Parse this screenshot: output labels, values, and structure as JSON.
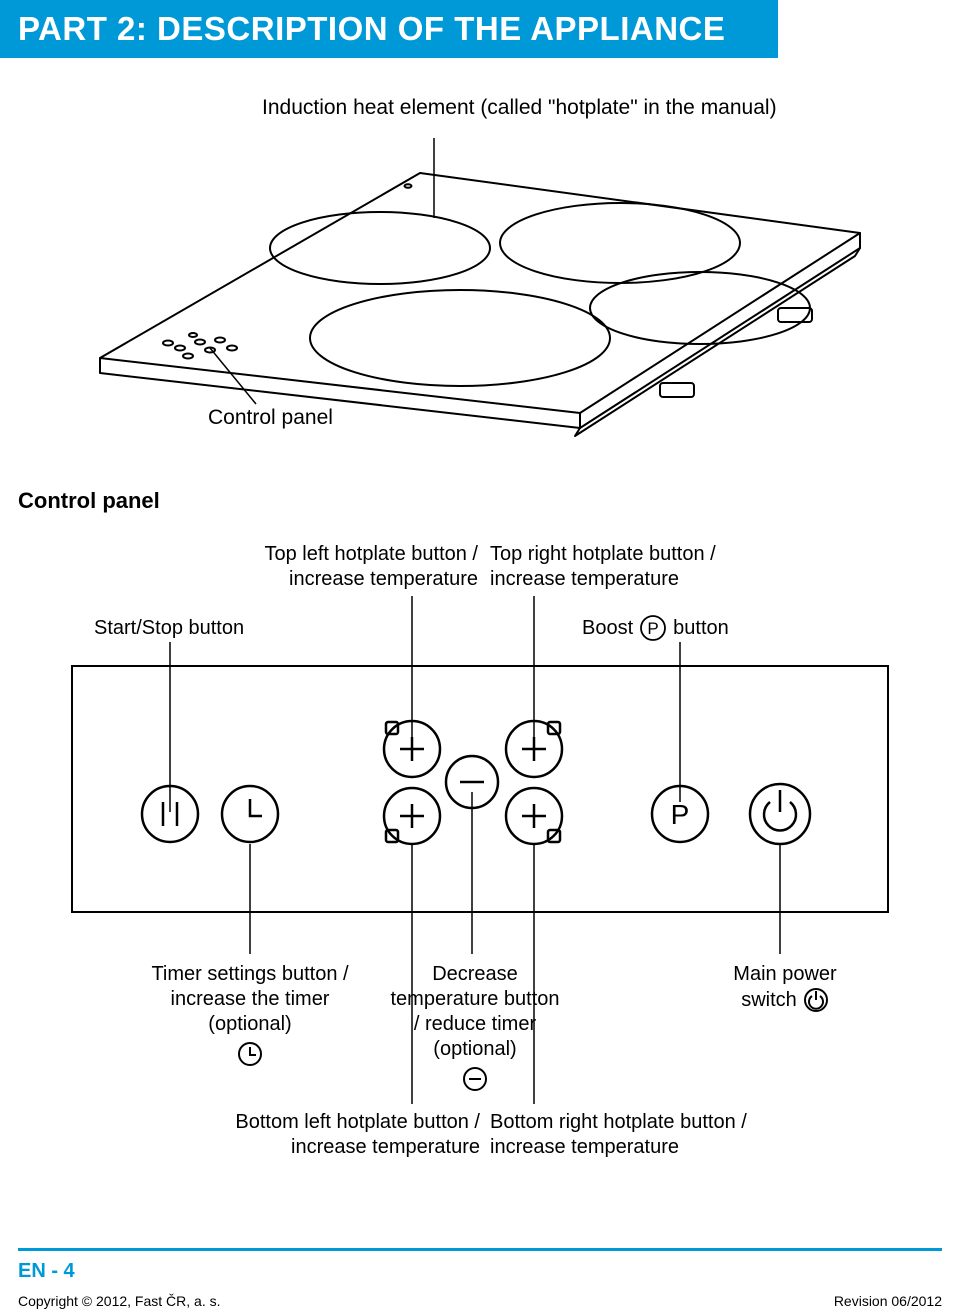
{
  "title": "PART 2: DESCRIPTION OF THE APPLIANCE",
  "appliance": {
    "hotplate_label": "Induction heat element (called \"hotplate\" in the manual)",
    "control_panel_label": "Control panel"
  },
  "section_header": "Control panel",
  "labels": {
    "top_left": "Top left hotplate button / increase temperature",
    "top_right": "Top right hotplate button / increase temperature",
    "start_stop": "Start/Stop button",
    "boost_pre": "Boost",
    "boost_post": "button",
    "timer": "Timer settings button / increase the timer (optional)",
    "decrease": "Decrease temperature button / reduce timer (optional)",
    "main_power_1": "Main power",
    "main_power_2": "switch",
    "bottom_left": "Bottom left hotplate button / increase temperature",
    "bottom_right": "Bottom right hotplate button / increase temperature"
  },
  "footer": {
    "page": "EN - 4",
    "copyright": "Copyright © 2012, Fast ČR, a. s.",
    "revision": "Revision 06/2012"
  }
}
